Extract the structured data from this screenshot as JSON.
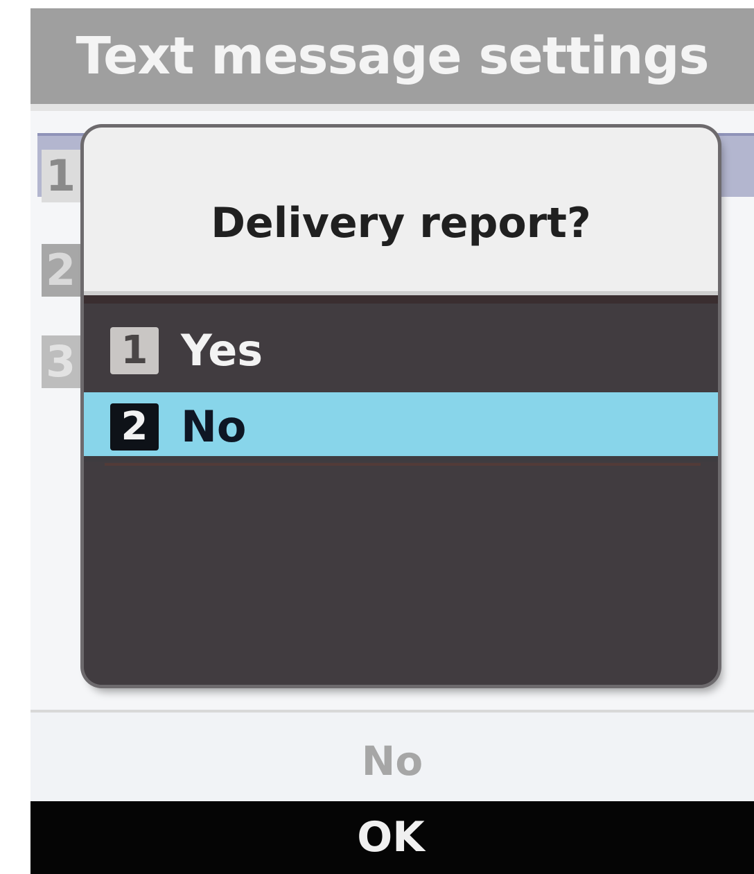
{
  "screen": {
    "title": "Text message settings"
  },
  "background_list": {
    "items": [
      {
        "number": "1"
      },
      {
        "number": "2"
      },
      {
        "number": "3"
      }
    ]
  },
  "dialog": {
    "title": "Delivery report?",
    "options": [
      {
        "number": "1",
        "label": "Yes",
        "selected": false
      },
      {
        "number": "2",
        "label": "No",
        "selected": true
      }
    ]
  },
  "current_value": "No",
  "softkey": {
    "center_label": "OK"
  },
  "colors": {
    "title_bar": "#9f9f9f",
    "dialog_body": "#413c40",
    "dialog_header": "#efefef",
    "selection_highlight": "#88d5ea",
    "bottom_bar": "#050505"
  }
}
